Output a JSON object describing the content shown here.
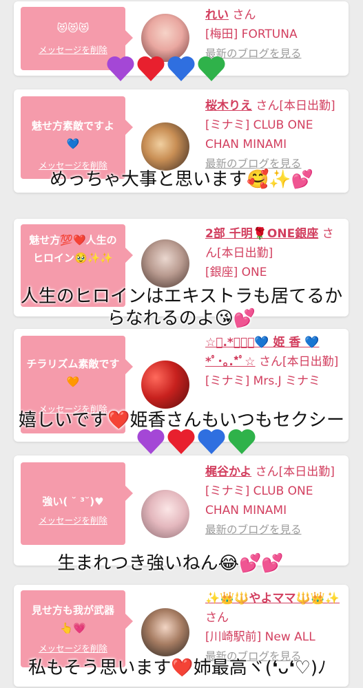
{
  "common": {
    "delete_label": "メッセージを削除",
    "blog_label": "最新のブログを見る",
    "san_label": "さん"
  },
  "cards": [
    {
      "message": "😻😻😻",
      "name": "れい",
      "san_extra": "",
      "shop": "[梅田] FORTUNA"
    },
    {
      "message": "魅せ方素敵ですよ💙",
      "name": "桜木りえ",
      "san_extra": "[本日出勤]",
      "shop": "[ミナミ] CLUB ONE CHAN MINAMI"
    },
    {
      "message": "魅せ方💯❤️人生のヒロイン🥹✨✨",
      "name": "2部 千明🌹ONE銀座",
      "san_extra": "[本日出勤]",
      "shop": "[銀座] ONE"
    },
    {
      "message": "チラリズム素敵です🧡",
      "name": "☆ﾟ.*･｡ﾟ💙 姫 香 💙*ﾟ･｡.*ﾟ☆",
      "san_extra": "[本日出勤]",
      "shop": "[ミナミ] Mrs.J ミナミ"
    },
    {
      "message": "強い( ˘ ³˘)♥",
      "name": "梶谷かよ",
      "san_extra": "[本日出勤]",
      "shop": "[ミナミ] CLUB ONE CHAN MINAMI"
    },
    {
      "message": "見せ方も我が武器👆💗",
      "name": "✨👑🔱やよママ🔱👑✨",
      "san_extra": "",
      "shop": "[川崎駅前] New ALL"
    }
  ],
  "overlays": [
    "めっちゃ大事と思います🥰✨💕",
    "人生のヒロインはエキストラも居てるか",
    "らなれるのよ😘💕",
    "嬉しいです❤️姫香さんもいつもセクシー",
    "生まれつき強いねん😂💕💕",
    "私もそう思います❤️姉最高ヾ(❛ᴗ❛♡)ﾉ"
  ],
  "heart_colors": [
    "#a447d6",
    "#e8202e",
    "#2f6fe0",
    "#2fb24a"
  ],
  "colors": {
    "accent_pink": "#f59bab",
    "name_red": "#d23f5f",
    "background": "#ececec"
  }
}
